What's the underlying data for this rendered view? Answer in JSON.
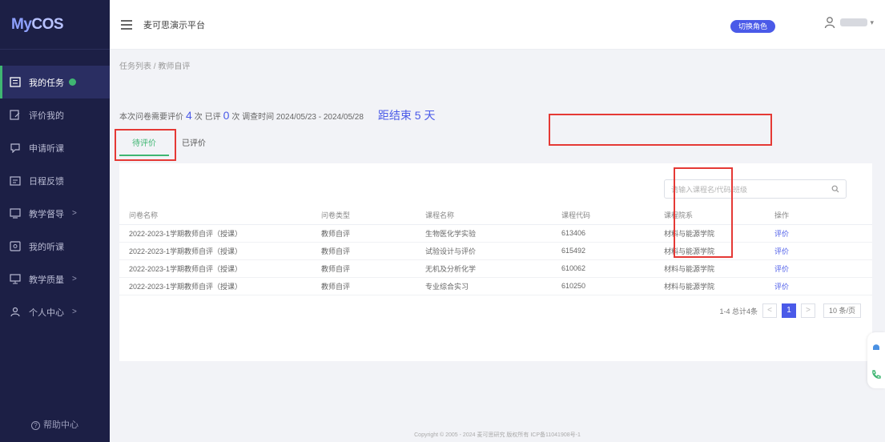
{
  "app": {
    "logo": "MyCOS",
    "logo_prefix": "My",
    "logo_suffix": "COS"
  },
  "sidebar": {
    "items": [
      {
        "label": "我的任务",
        "icon": "task-list-icon",
        "active": true,
        "badge": true
      },
      {
        "label": "评价我的",
        "icon": "evaluate-me-icon"
      },
      {
        "label": "申请听课",
        "icon": "apply-lecture-icon"
      },
      {
        "label": "日程反馈",
        "icon": "schedule-feedback-icon"
      },
      {
        "label": "教学督导",
        "icon": "supervision-icon",
        "arrow": ">"
      },
      {
        "label": "我的听课",
        "icon": "my-lecture-icon"
      },
      {
        "label": "教学质量",
        "icon": "quality-icon",
        "arrow": ">"
      },
      {
        "label": "个人中心",
        "icon": "person-icon",
        "arrow": ">"
      }
    ],
    "help": "帮助中心"
  },
  "header": {
    "platform_title": "麦可思演示平台",
    "role_badge": "切换角色",
    "user_caret": "▾"
  },
  "breadcrumb": "任务列表 / 教师自评",
  "summary": {
    "text1": "本次问卷需要评价",
    "count_total": "4",
    "text2": "次 已评",
    "count_done": "0",
    "text3": "次 调查时间 2024/05/23 - 2024/05/28",
    "deadline": "距结束 5 天"
  },
  "tabs": [
    {
      "label": "待评价",
      "active": true
    },
    {
      "label": "已评价",
      "active": false
    }
  ],
  "search": {
    "placeholder": "请输入课程名/代码/班级"
  },
  "table": {
    "headers": [
      "问卷名称",
      "问卷类型",
      "课程名称",
      "课程代码",
      "课程院系",
      "操作"
    ],
    "rows": [
      [
        "2022-2023-1学期教师自评（授课）",
        "教师自评",
        "生物医化学实验",
        "613406",
        "材料与能源学院",
        "评价"
      ],
      [
        "2022-2023-1学期教师自评（授课）",
        "教师自评",
        "试验设计与评价",
        "615492",
        "材料与能源学院",
        "评价"
      ],
      [
        "2022-2023-1学期教师自评（授课）",
        "教师自评",
        "无机及分析化学",
        "610062",
        "材料与能源学院",
        "评价"
      ],
      [
        "2022-2023-1学期教师自评（授课）",
        "教师自评",
        "专业综合实习",
        "610250",
        "材料与能源学院",
        "评价"
      ]
    ]
  },
  "pagination": {
    "summary": "1-4 总计4条",
    "prev": "<",
    "current": "1",
    "next": ">",
    "page_size": "10 条/页"
  },
  "footer": "Copyright © 2005 - 2024 麦可思研究 版权所有 ICP备11041908号-1",
  "colors": {
    "sidebar_bg": "#1c1f45",
    "accent": "#4a5ae8",
    "active_green": "#3fb672",
    "highlight_red": "#e53935"
  }
}
